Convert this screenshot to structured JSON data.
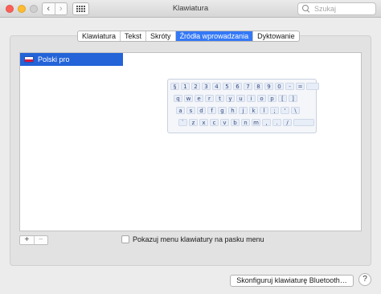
{
  "window": {
    "title": "Klawiatura"
  },
  "toolbar": {
    "back_glyph": "‹",
    "forward_glyph": "›"
  },
  "search": {
    "placeholder": "Szukaj"
  },
  "tabs": [
    {
      "label": "Klawiatura",
      "active": false
    },
    {
      "label": "Tekst",
      "active": false
    },
    {
      "label": "Skróty",
      "active": false
    },
    {
      "label": "Źródła wprowadzania",
      "active": true
    },
    {
      "label": "Dyktowanie",
      "active": false
    }
  ],
  "input_sources": [
    {
      "label": "Polski pro",
      "flag": "poland-flag-icon",
      "selected": true
    }
  ],
  "keyboard_preview": {
    "rows": [
      [
        "§",
        "1",
        "2",
        "3",
        "4",
        "5",
        "6",
        "7",
        "8",
        "9",
        "0",
        "-",
        "="
      ],
      [
        "q",
        "w",
        "e",
        "r",
        "t",
        "y",
        "u",
        "i",
        "o",
        "p",
        "[",
        "]"
      ],
      [
        "a",
        "s",
        "d",
        "f",
        "g",
        "h",
        "j",
        "k",
        "l",
        ";",
        "'",
        "\\"
      ],
      [
        "`",
        "z",
        "x",
        "c",
        "v",
        "b",
        "n",
        "m",
        ",",
        ".",
        "/"
      ]
    ]
  },
  "list_controls": {
    "add": "+",
    "remove": "−"
  },
  "show_menu_checkbox": {
    "label": "Pokazuj menu klawiatury na pasku menu",
    "checked": false
  },
  "bluetooth_button": {
    "label": "Skonfiguruj klawiaturę Bluetooth…"
  },
  "help_button": {
    "label": "?"
  },
  "colors": {
    "accent": "#3478f6",
    "selection": "#2463d8"
  }
}
